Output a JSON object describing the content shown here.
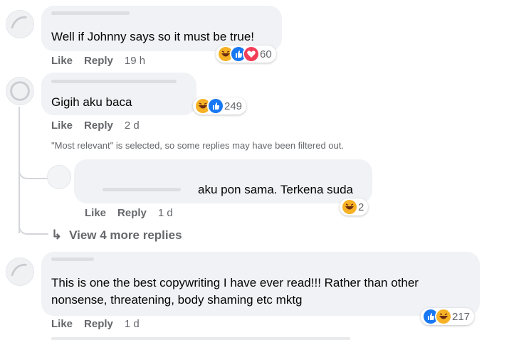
{
  "comments": [
    {
      "text": "Well if Johnny says so it must be true!",
      "like": "Like",
      "reply": "Reply",
      "time": "19 h",
      "reactions": [
        "haha-icon",
        "like-icon",
        "love-icon"
      ],
      "reaction_count": "60"
    },
    {
      "text": "Gigih aku baca",
      "like": "Like",
      "reply": "Reply",
      "time": "2 d",
      "reactions": [
        "haha-icon",
        "like-icon"
      ],
      "reaction_count": "249",
      "filter_notice": "\"Most relevant\" is selected, so some replies may have been filtered out.",
      "reply_item": {
        "text": "aku pon sama. Terkena suda",
        "like": "Like",
        "reply": "Reply",
        "time": "1 d",
        "reactions": [
          "haha-icon"
        ],
        "reaction_count": "2"
      },
      "view_more": "View 4 more replies"
    },
    {
      "text": "This is one the best copywriting I have ever read!!! Rather than other nonsense, threatening, body shaming etc mktg",
      "like": "Like",
      "reply": "Reply",
      "time": "1 d",
      "reactions": [
        "like-icon",
        "haha-icon"
      ],
      "reaction_count": "217"
    }
  ],
  "colors": {
    "bubble": "#f0f2f5",
    "secondary_text": "#65676b",
    "like_blue": "#1877f2",
    "love_red": "#f33e58",
    "haha_yellow": "#f7b125"
  }
}
